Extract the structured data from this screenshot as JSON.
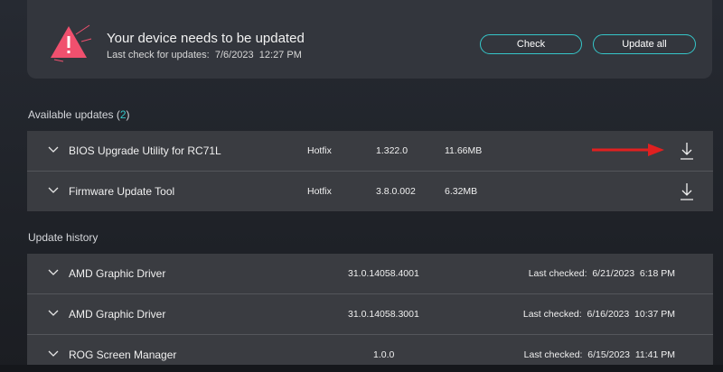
{
  "banner": {
    "title": "Your device needs to be updated",
    "last_check": "Last check for updates:  7/6/2023  12:27 PM",
    "check_label": "Check",
    "update_all_label": "Update all",
    "icon": "warning-triangle-icon"
  },
  "available": {
    "heading": "Available updates (",
    "count": "2",
    "close": ")",
    "rows": [
      {
        "name": "BIOS Upgrade Utility for RC71L",
        "type": "Hotfix",
        "version": "1.322.0",
        "size": "11.66MB"
      },
      {
        "name": "Firmware Update Tool",
        "type": "Hotfix",
        "version": "3.8.0.002",
        "size": "6.32MB"
      }
    ]
  },
  "history": {
    "heading": "Update history",
    "rows": [
      {
        "name": "AMD Graphic Driver",
        "version": "31.0.14058.4001",
        "checked": "Last checked:  6/21/2023  6:18 PM"
      },
      {
        "name": "AMD Graphic Driver",
        "version": "31.0.14058.3001",
        "checked": "Last checked:  6/16/2023  10:37 PM"
      },
      {
        "name": "ROG Screen Manager",
        "version": "1.0.0",
        "checked": "Last checked:  6/15/2023  11:41 PM"
      }
    ]
  },
  "colors": {
    "accent": "#35c6c9",
    "warning": "#f0506e",
    "annotation_arrow": "#e02020"
  }
}
